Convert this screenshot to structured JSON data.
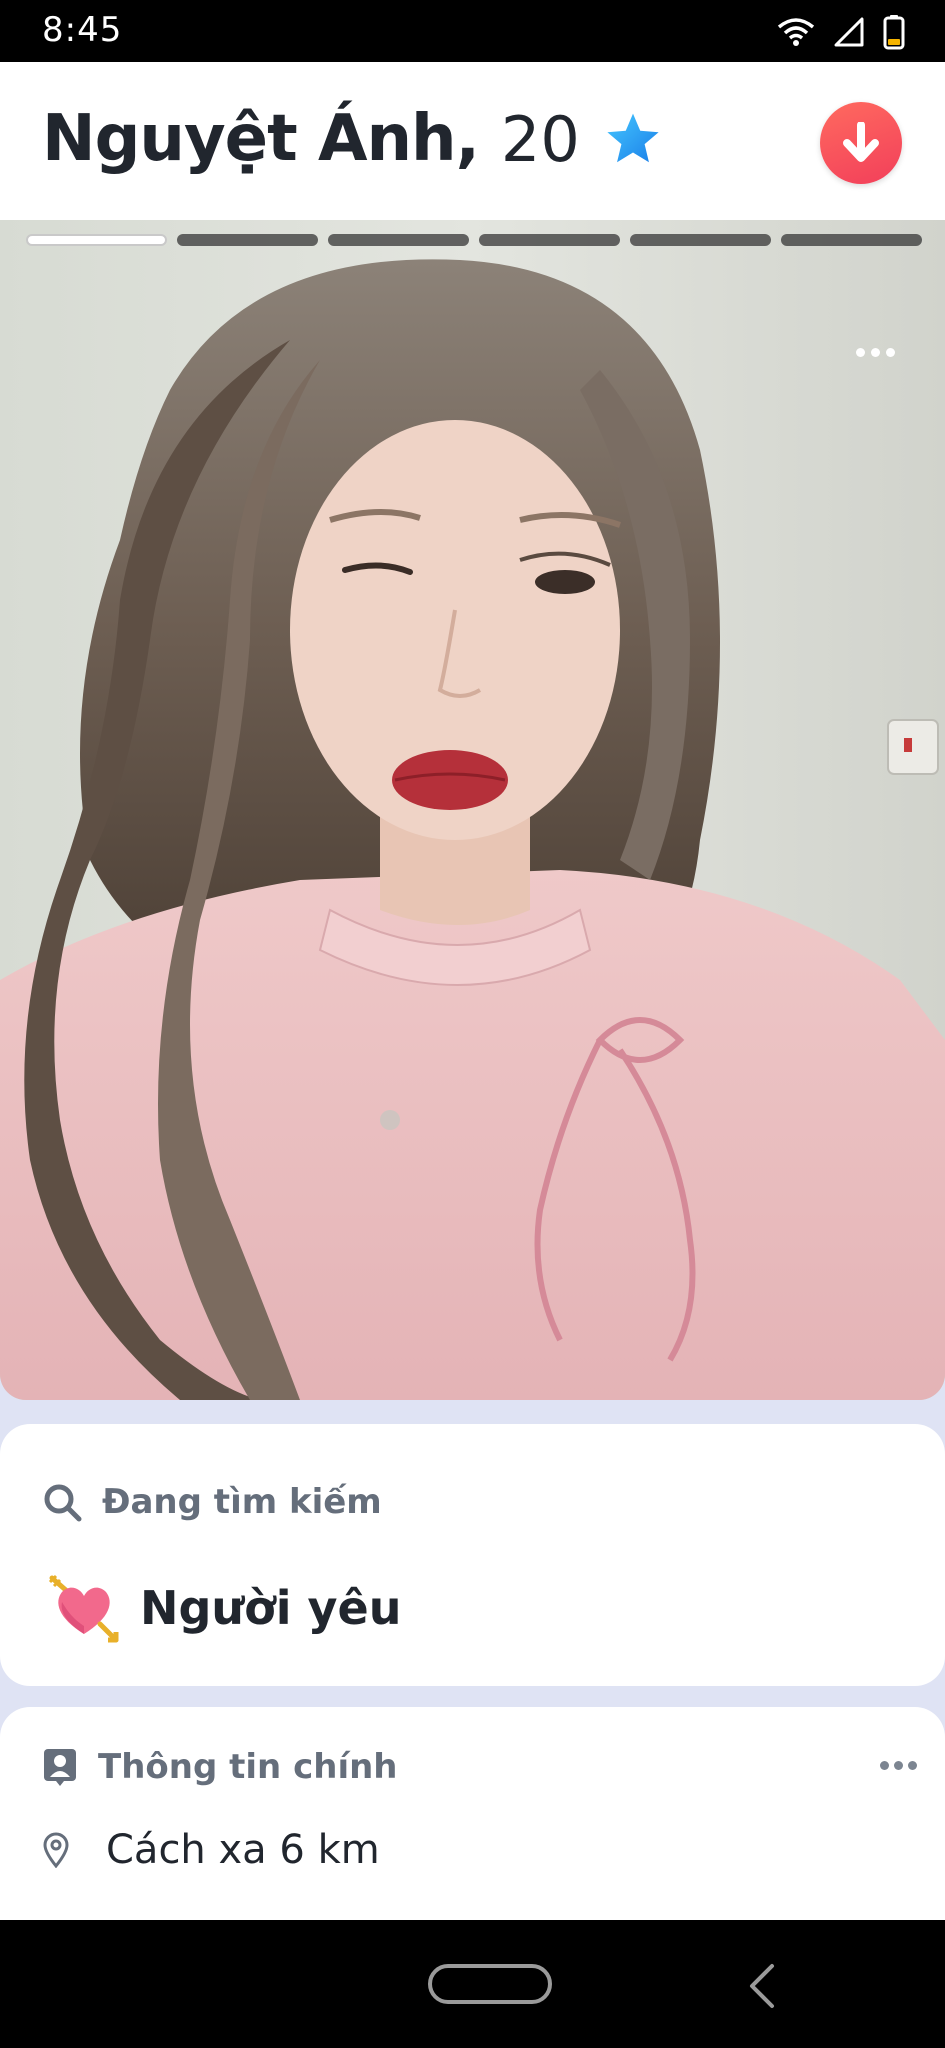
{
  "status_bar": {
    "time": "8:45",
    "icons": [
      "wifi-icon",
      "signal-icon",
      "battery-icon"
    ]
  },
  "profile": {
    "name": "Nguyệt Ánh,",
    "age": "20",
    "verified_icon": "star-icon",
    "collapse_icon": "arrow-down-icon",
    "accent_color": "#fd4c5c",
    "verified_color": "#1d9bf0"
  },
  "photo": {
    "total_photos": 6,
    "active_index": 0,
    "more_icon": "more-horizontal-icon"
  },
  "looking_for": {
    "header_label": "Đang tìm kiếm",
    "header_icon": "search-icon",
    "emoji_icon": "heart-with-arrow-icon",
    "value": "Người yêu"
  },
  "basic_info": {
    "header_label": "Thông tin chính",
    "header_icon": "profile-card-icon",
    "menu_icon": "more-horizontal-icon",
    "distance_icon": "location-pin-icon",
    "distance": "Cách xa 6 km"
  },
  "nav_bar": {
    "home_icon": "home-pill-icon",
    "back_icon": "back-chevron-icon"
  }
}
